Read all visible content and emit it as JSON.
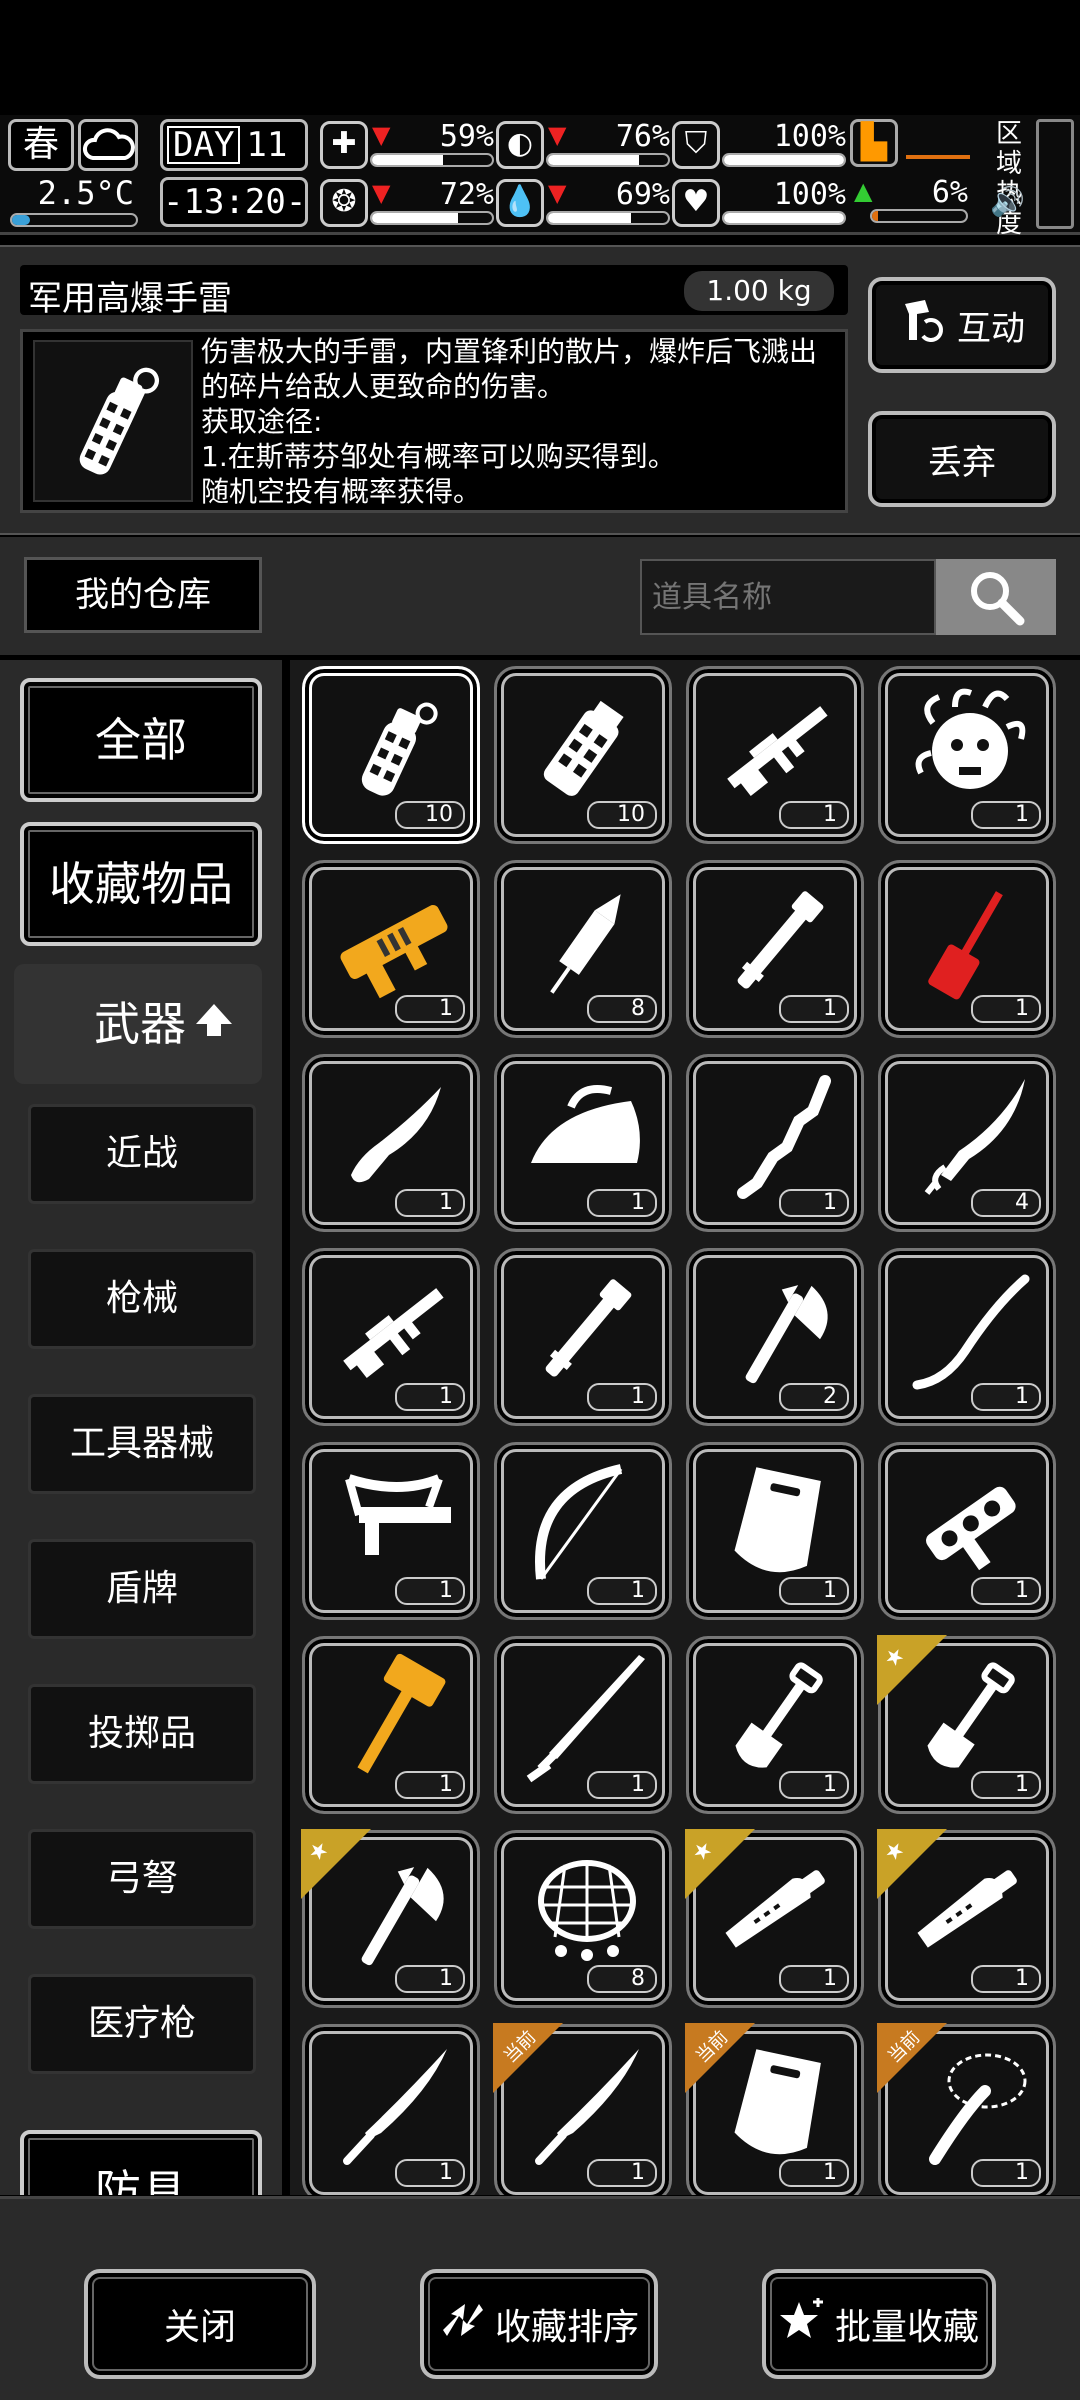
{
  "status": {
    "season": "春",
    "temperature": "2.5°C",
    "day_label": "DAY",
    "day_number": "11",
    "clock": "-13:20-",
    "gauges": [
      {
        "icon": "medkit-icon",
        "symbol": "✚",
        "pct": "59%",
        "value": 59,
        "trend": "down"
      },
      {
        "icon": "stomach-icon",
        "symbol": "◐",
        "pct": "76%",
        "value": 76,
        "trend": "down"
      },
      {
        "icon": "armor-icon",
        "symbol": "⛉",
        "pct": "100%",
        "value": 100,
        "trend": ""
      },
      {
        "icon": "brain-icon",
        "symbol": "❂",
        "pct": "72%",
        "value": 72,
        "trend": "down"
      },
      {
        "icon": "water-drop-icon",
        "symbol": "💧",
        "pct": "69%",
        "value": 69,
        "trend": "down"
      },
      {
        "icon": "heart-icon",
        "symbol": "♥",
        "pct": "100%",
        "value": 100,
        "trend": ""
      }
    ],
    "stamina_pct": "6%",
    "region_label": "区域\n热度"
  },
  "detail": {
    "name": "军用高爆手雷",
    "weight": "1.00 kg",
    "description": "伤害极大的手雷，内置锋利的散片，爆炸后飞溅出的碎片给敌人更致命的伤害。\n获取途径:\n1.在斯蒂芬邹处有概率可以购买得到。\n随机空投有概率获得。",
    "interact_label": "互动",
    "discard_label": "丢弃"
  },
  "storage": {
    "title": "我的仓库",
    "search_placeholder": "道具名称"
  },
  "nav": {
    "all": "全部",
    "favorites": "收藏物品",
    "weapons": "武器",
    "sub": [
      "近战",
      "枪械",
      "工具器械",
      "盾牌",
      "投掷品",
      "弓弩",
      "医疗枪"
    ],
    "next": "防具"
  },
  "items": [
    {
      "icon": "grenade",
      "qty": "10",
      "color": "#ffffff",
      "selected": true
    },
    {
      "icon": "grenade2",
      "qty": "10",
      "color": "#ffffff"
    },
    {
      "icon": "rifle",
      "qty": "1",
      "color": "#ffffff"
    },
    {
      "icon": "mask",
      "qty": "1",
      "color": "#ffffff"
    },
    {
      "icon": "blaster",
      "qty": "1",
      "color": "#f2a81d"
    },
    {
      "icon": "firework",
      "qty": "8",
      "color": "#ffffff"
    },
    {
      "icon": "pipe",
      "qty": "1",
      "color": "#ffffff"
    },
    {
      "icon": "spatula",
      "qty": "1",
      "color": "#e02020"
    },
    {
      "icon": "knife",
      "qty": "1",
      "color": "#ffffff"
    },
    {
      "icon": "iron",
      "qty": "1",
      "color": "#ffffff"
    },
    {
      "icon": "stick",
      "qty": "1",
      "color": "#ffffff"
    },
    {
      "icon": "blade",
      "qty": "4",
      "color": "#ffffff"
    },
    {
      "icon": "rifle",
      "qty": "1",
      "color": "#ffffff"
    },
    {
      "icon": "pipe",
      "qty": "1",
      "color": "#ffffff"
    },
    {
      "icon": "axe",
      "qty": "2",
      "color": "#ffffff"
    },
    {
      "icon": "whip",
      "qty": "1",
      "color": "#ffffff"
    },
    {
      "icon": "crossbow",
      "qty": "1",
      "color": "#ffffff"
    },
    {
      "icon": "bow",
      "qty": "1",
      "color": "#ffffff"
    },
    {
      "icon": "shield",
      "qty": "1",
      "color": "#ffffff"
    },
    {
      "icon": "ornate",
      "qty": "1",
      "color": "#ffffff"
    },
    {
      "icon": "hammer",
      "qty": "1",
      "color": "#f2a81d"
    },
    {
      "icon": "katana",
      "qty": "1",
      "color": "#ffffff"
    },
    {
      "icon": "shovel",
      "qty": "1",
      "color": "#ffffff"
    },
    {
      "icon": "shovel",
      "qty": "1",
      "color": "#ffffff",
      "ribbon": "star"
    },
    {
      "icon": "axe",
      "qty": "1",
      "color": "#ffffff",
      "ribbon": "star"
    },
    {
      "icon": "net",
      "qty": "8",
      "color": "#ffffff"
    },
    {
      "icon": "machete",
      "qty": "1",
      "color": "#ffffff",
      "ribbon": "star"
    },
    {
      "icon": "machete",
      "qty": "1",
      "color": "#ffffff",
      "ribbon": "star"
    },
    {
      "icon": "sword",
      "qty": "1",
      "color": "#ffffff"
    },
    {
      "icon": "sword",
      "qty": "1",
      "color": "#ffffff",
      "ribbon": "当前"
    },
    {
      "icon": "shield",
      "qty": "1",
      "color": "#ffffff",
      "ribbon": "当前"
    },
    {
      "icon": "lasso",
      "qty": "1",
      "color": "#ffffff",
      "ribbon": "当前"
    }
  ],
  "bottom": {
    "close": "关闭",
    "sort": "收藏排序",
    "batch": "批量收藏"
  }
}
